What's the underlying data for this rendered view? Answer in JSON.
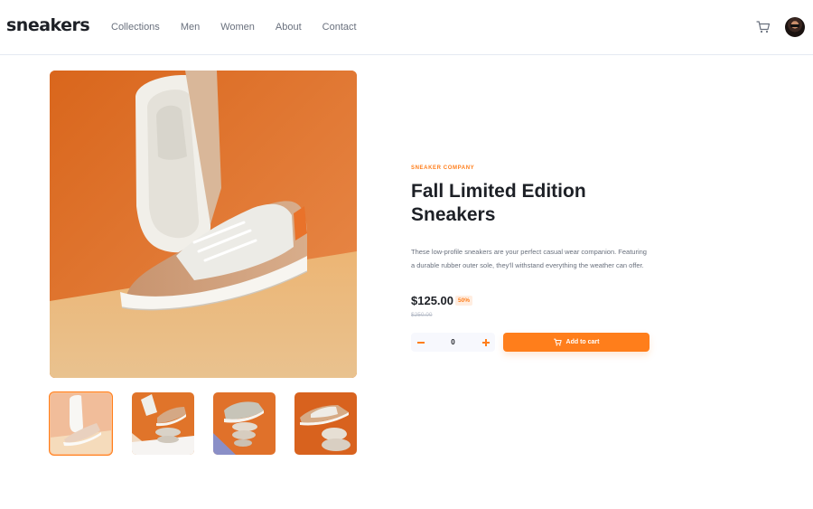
{
  "brand": {
    "logo": "sneakers"
  },
  "nav": {
    "items": [
      {
        "label": "Collections"
      },
      {
        "label": "Men"
      },
      {
        "label": "Women"
      },
      {
        "label": "About"
      },
      {
        "label": "Contact"
      }
    ]
  },
  "header": {
    "cart_icon": "cart-icon",
    "avatar_icon": "avatar"
  },
  "product": {
    "company": "SNEAKER COMPANY",
    "title_line1": "Fall Limited Edition",
    "title_line2": "Sneakers",
    "description": "These low-profile sneakers are your perfect casual wear companion. Featuring a durable rubber outer sole, they'll withstand everything the weather can offer.",
    "price": "$125.00",
    "discount": "50%",
    "old_price": "$250.00",
    "quantity": "0",
    "add_to_cart_label": "Add to cart"
  },
  "gallery": {
    "active_index": 0,
    "thumbnail_count": 4
  },
  "colors": {
    "accent": "#ff7e1b",
    "accent_pale": "#ffede0",
    "text_dark": "#1d2026",
    "text_grey": "#69707d",
    "image_orange": "#e47a2b"
  }
}
